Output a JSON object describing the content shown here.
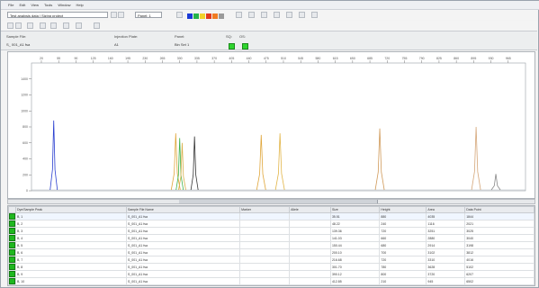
{
  "menu": [
    "File",
    "Edit",
    "View",
    "Tools",
    "Window",
    "Help"
  ],
  "toolbar": {
    "project_select": "Test analysis data / Sizing project",
    "panel_select": "Panel: 1",
    "dye_colors": [
      "#1a3bd6",
      "#25b34a",
      "#f2d22a",
      "#e23a1c",
      "#f07b22",
      "#9a9a9a"
    ]
  },
  "info": {
    "sample_label": "Sample File:",
    "sample_value": "S_ 001_A1 fsa",
    "lane_label": "Injection Plate:",
    "lane_value": "A1",
    "panel_label": "Panel:",
    "panel_value": "Bin Set 1",
    "size_std_label": "SQ:",
    "sq_label": "OS:"
  },
  "chart_data": {
    "type": "line",
    "title": "",
    "xlabel": "",
    "ylabel": "",
    "xlim": [
      0,
      1000
    ],
    "ylim": [
      0,
      1600
    ],
    "x_ticks": [
      20,
      55,
      90,
      125,
      160,
      195,
      230,
      265,
      300,
      335,
      370,
      405,
      440,
      475,
      510,
      545,
      580,
      615,
      650,
      685,
      720,
      755,
      790,
      825,
      860,
      895,
      930,
      965
    ],
    "y_ticks": [
      0,
      200,
      400,
      600,
      800,
      1000,
      1200,
      1400
    ],
    "peaks": [
      {
        "x": 45,
        "height": 880,
        "width": 4,
        "color": "#2a3fd0"
      },
      {
        "x": 292,
        "height": 720,
        "width": 5,
        "color": "#e0a63a"
      },
      {
        "x": 300,
        "height": 660,
        "width": 4,
        "color": "#3fb24a"
      },
      {
        "x": 305,
        "height": 600,
        "width": 4,
        "color": "#d8b04a"
      },
      {
        "x": 330,
        "height": 680,
        "width": 4,
        "color": "#333333"
      },
      {
        "x": 465,
        "height": 700,
        "width": 5,
        "color": "#e0a63a"
      },
      {
        "x": 503,
        "height": 720,
        "width": 5,
        "color": "#e2b548"
      },
      {
        "x": 705,
        "height": 780,
        "width": 5,
        "color": "#d09a5a"
      },
      {
        "x": 900,
        "height": 800,
        "width": 5,
        "color": "#d5a77a"
      },
      {
        "x": 940,
        "height": 210,
        "width": 5,
        "color": "#888888"
      }
    ]
  },
  "table": {
    "columns": [
      "",
      "Dye/Sample Peak",
      "Sample File Name",
      "Marker",
      "Allele",
      "Size",
      "Height",
      "Area",
      "Data Point"
    ],
    "rows": [
      [
        "B, 1",
        "S_001_A1 fsa",
        "",
        "",
        "35.51",
        "880",
        "4035",
        "1844"
      ],
      [
        "B, 2",
        "S_001_A1 fsa",
        "",
        "",
        "48.22",
        "240",
        "1116",
        "2021"
      ],
      [
        "B, 3",
        "S_001_A1 fsa",
        "",
        "",
        "139.36",
        "720",
        "3251",
        "3025"
      ],
      [
        "B, 4",
        "S_001_A1 fsa",
        "",
        "",
        "141.03",
        "660",
        "2880",
        "3040"
      ],
      [
        "B, 5",
        "S_001_A1 fsa",
        "",
        "",
        "150.44",
        "680",
        "2914",
        "3198"
      ],
      [
        "B, 6",
        "S_001_A1 fsa",
        "",
        "",
        "200.10",
        "700",
        "3102",
        "3812"
      ],
      [
        "B, 7",
        "S_001_A1 fsa",
        "",
        "",
        "216.68",
        "720",
        "3310",
        "4016"
      ],
      [
        "B, 8",
        "S_001_A1 fsa",
        "",
        "",
        "301.70",
        "780",
        "3628",
        "5102"
      ],
      [
        "B, 9",
        "S_001_A1 fsa",
        "",
        "",
        "390.12",
        "800",
        "3720",
        "6207"
      ],
      [
        "B, 10",
        "S_001_A1 fsa",
        "",
        "",
        "412.85",
        "210",
        "945",
        "6502"
      ]
    ]
  }
}
